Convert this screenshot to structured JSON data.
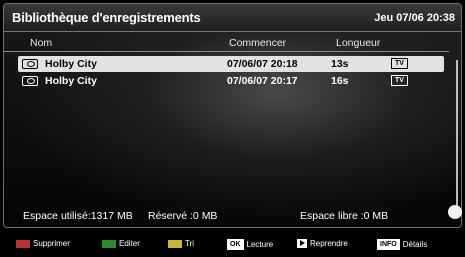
{
  "header": {
    "title": "Bibliothèque d'enregistrements",
    "datetime": "Jeu 07/06 20:38"
  },
  "columns": {
    "name": "Nom",
    "start": "Commencer",
    "length": "Longueur"
  },
  "recordings": [
    {
      "name": "Holby City",
      "start": "07/06/07  20:18",
      "length": "13s",
      "type": "TV",
      "selected": true
    },
    {
      "name": "Holby City",
      "start": "07/06/07  20:17",
      "length": "16s",
      "type": "TV",
      "selected": false
    }
  ],
  "status": {
    "used": "Espace utilisé:1317 MB",
    "reserved": "Réservé :0 MB",
    "free": "Espace libre :0 MB"
  },
  "legend": {
    "red": "Supprimer",
    "green": "Editer",
    "yellow": "Tri",
    "ok_key": "OK",
    "ok": "Lecture",
    "play": "Reprendre",
    "info_key": "INFO",
    "info": "Détails"
  },
  "colors": {
    "red": "#b43232",
    "green": "#2f8a2f",
    "yellow": "#c9b43a",
    "blue": "#2f4fb0",
    "selected_row": "#e2e2e2"
  }
}
